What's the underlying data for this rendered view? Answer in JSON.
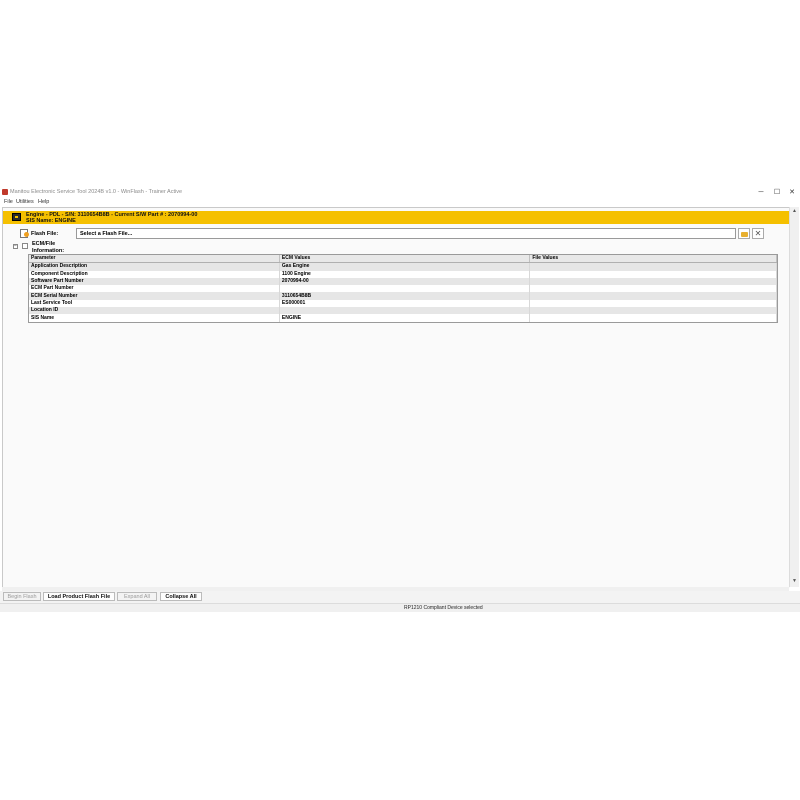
{
  "window": {
    "title": "Manitou Electronic Service Tool 2024B v1.0 - WinFlash - Trainer Active",
    "accent": "#f5c000",
    "min_label": "─",
    "max_label": "☐",
    "close_label": "✕"
  },
  "menu": {
    "items": [
      "File",
      "Utilities",
      "Help"
    ]
  },
  "ecu": {
    "line1": "Engine - PDL - S/N: 3110654B8B - Current S/W Part # : 2070994-00",
    "line2": "SIS Name: ENGINE"
  },
  "flash": {
    "label": "Flash File:",
    "value": "Select a Flash File...",
    "clear_glyph": "✕"
  },
  "tree": {
    "toggle": "−",
    "label_line1": "ECM/File",
    "label_line2": "Information:"
  },
  "table": {
    "headers": [
      "Parameter",
      "ECM Values",
      "File Values"
    ],
    "rows": [
      [
        "Application Description",
        "Gas Engine",
        ""
      ],
      [
        "Component Description",
        "1100 Engine",
        ""
      ],
      [
        "Software Part Number",
        "2070994-00",
        ""
      ],
      [
        "ECM Part Number",
        "",
        ""
      ],
      [
        "ECM Serial Number",
        "3110654B8B",
        ""
      ],
      [
        "Last Service Tool",
        "ES000001",
        ""
      ],
      [
        "Location ID",
        "",
        ""
      ],
      [
        "SIS Name",
        "ENGINE",
        ""
      ]
    ]
  },
  "actions": {
    "begin_flash": "Begin Flash",
    "load_product": "Load Product Flash File",
    "expand_all": "Expand All",
    "collapse_all": "Collapse All"
  },
  "status": {
    "text": "RP1210 Compliant Device selected"
  }
}
